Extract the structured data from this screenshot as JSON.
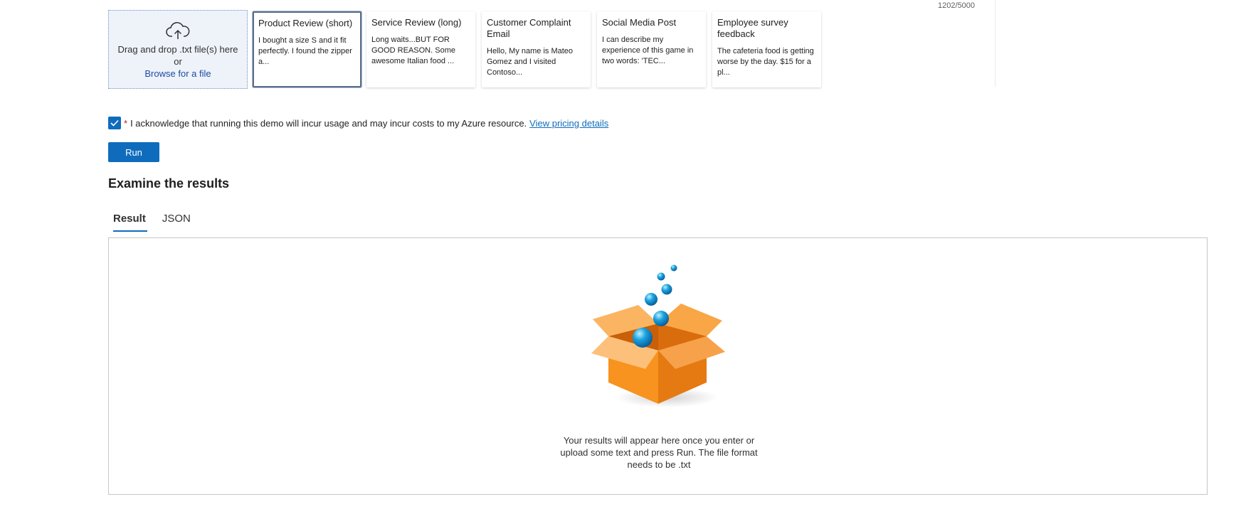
{
  "char_count": "1202/5000",
  "dropzone": {
    "icon": "cloud-upload-icon",
    "line1": "Drag and drop .txt file(s) here",
    "line2": "or",
    "link": "Browse for a file"
  },
  "samples": [
    {
      "title": "Product Review (short)",
      "body": "I bought a size S and it fit perfectly. I found the zipper a...",
      "selected": true
    },
    {
      "title": "Service Review (long)",
      "body": "Long waits...BUT FOR GOOD REASON. Some awesome Italian food ...",
      "selected": false
    },
    {
      "title": "Customer Complaint Email",
      "body": "Hello, My name is Mateo Gomez and I visited Contoso...",
      "selected": false
    },
    {
      "title": "Social Media Post",
      "body": "I can describe my experience of this game in two words: 'TEC...",
      "selected": false
    },
    {
      "title": "Employee survey feedback",
      "body": "The cafeteria food is getting worse by the day. $15 for a pl...",
      "selected": false
    }
  ],
  "acknowledge": {
    "checked": true,
    "required_mark": "*",
    "text": "I acknowledge that running this demo will incur usage and may incur costs to my Azure resource.",
    "link": "View pricing details"
  },
  "run_label": "Run",
  "results_title": "Examine the results",
  "tabs": [
    {
      "label": "Result",
      "active": true
    },
    {
      "label": "JSON",
      "active": false
    }
  ],
  "empty_state": {
    "illustration": "open-box-with-bubbles",
    "text": "Your results will appear here once you enter or upload some text and press Run. The file format needs to be .txt"
  },
  "colors": {
    "accent": "#0f6cbd",
    "box_orange": "#f7931e",
    "bubble_blue": "#1aa3e0"
  }
}
